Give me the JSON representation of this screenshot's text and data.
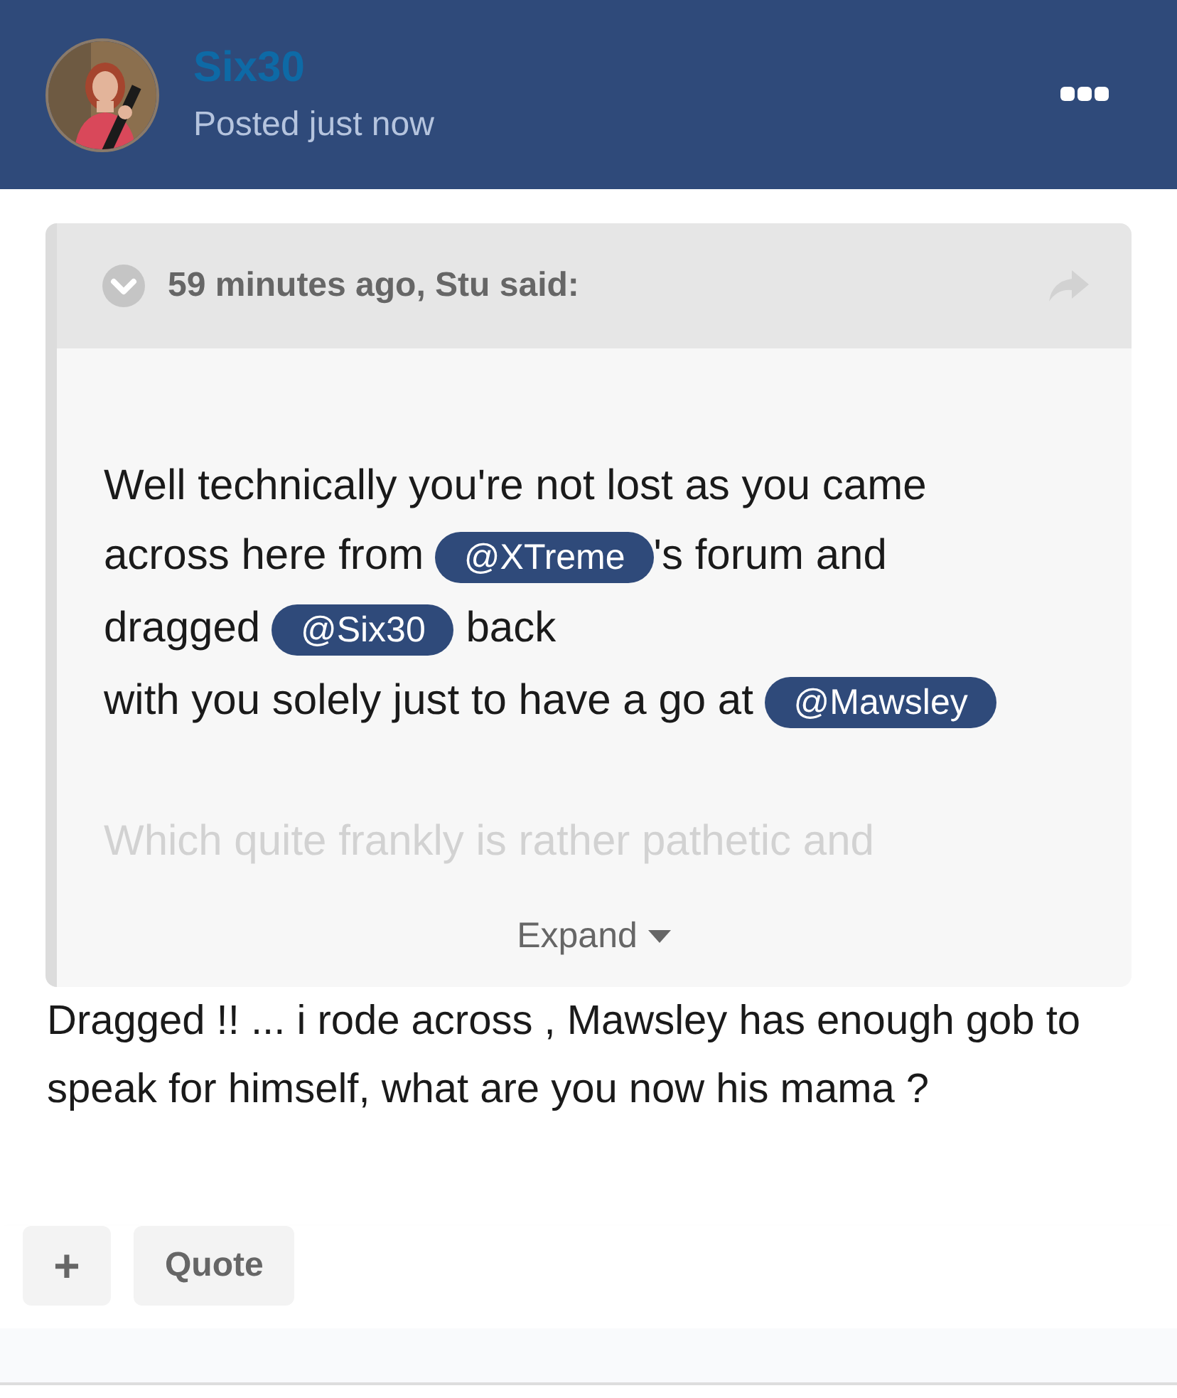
{
  "author": {
    "name": "Six30",
    "posted": "Posted just now"
  },
  "quote": {
    "citation": "59 minutes ago, Stu said:",
    "collapsed": true,
    "blocks": [
      {
        "kind": "paragraph",
        "segments": [
          {
            "kind": "text",
            "text": "Well technically you're not lost as you came across here from "
          },
          {
            "kind": "mention",
            "text": "@XTreme"
          },
          {
            "kind": "text",
            "text": "'s forum and dragged "
          },
          {
            "kind": "mention",
            "text": "@Six30"
          },
          {
            "kind": "text",
            "text": " back"
          }
        ]
      },
      {
        "kind": "paragraph",
        "segments": [
          {
            "kind": "text",
            "text": "with you solely just to have a go at "
          },
          {
            "kind": "mention",
            "text": "@Mawsley"
          }
        ]
      },
      {
        "kind": "faded",
        "segments": [
          {
            "kind": "text",
            "text": "Which quite frankly is rather pathetic and"
          }
        ]
      }
    ],
    "expand_label": "Expand"
  },
  "body": "Dragged !! ... i rode across , Mawsley has enough gob to speak for himself, what are you now his mama ?",
  "buttons": [
    {
      "kind": "icon",
      "text": "+"
    },
    {
      "kind": "text",
      "text": "Quote"
    }
  ]
}
